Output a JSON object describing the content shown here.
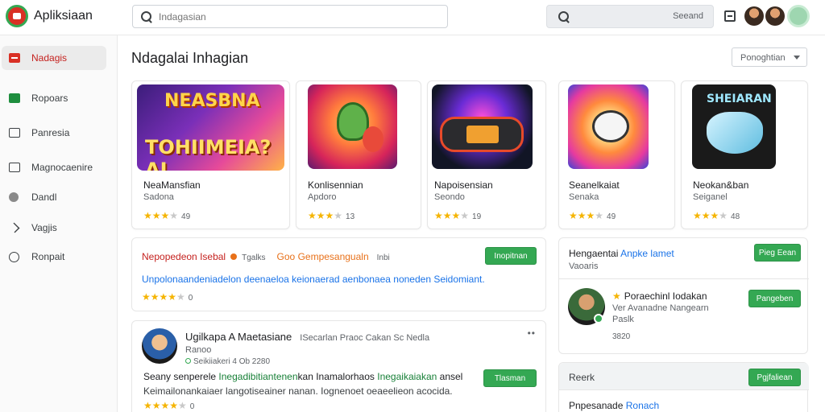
{
  "header": {
    "app_title": "Apliksiaan",
    "search_placeholder": "Indagasian",
    "second_search_label": "Seeand"
  },
  "sidebar": {
    "items": [
      {
        "label": "Nadagis",
        "icon": "red-square-icon",
        "active": true
      },
      {
        "label": "Ropoars",
        "icon": "green-store-icon",
        "active": false
      },
      {
        "label": "Panresia",
        "icon": "chart-icon",
        "active": false
      },
      {
        "label": "Magnocaenire",
        "icon": "grid-icon",
        "active": false
      },
      {
        "label": "Dandl",
        "icon": "circle-icon",
        "active": false
      },
      {
        "label": "Vagjis",
        "icon": "arrow-icon",
        "active": false
      },
      {
        "label": "Ronpait",
        "icon": "link-icon",
        "active": false
      }
    ]
  },
  "main": {
    "title": "Ndagalai Inhagian",
    "sort_label": "Ponoghtian"
  },
  "cards": [
    {
      "name": "NeaMansfian",
      "sub": "Sadona",
      "stars": 3,
      "rating": "49",
      "art_text1": "NEASBNA",
      "art_text2": "TOHIIMEIA?AL"
    },
    {
      "name": "Konlisennian",
      "sub": "Apdoro",
      "stars": 3,
      "rating": "13"
    },
    {
      "name": "Napoisensian",
      "sub": "Seondo",
      "stars": 3,
      "rating": "19"
    },
    {
      "name": "Seanelkaiat",
      "sub": "Senaka",
      "stars": 3,
      "rating": "49"
    },
    {
      "name": "Neokan&ban",
      "sub": "Seiganel",
      "stars": 3,
      "rating": "48",
      "art_text1": "SHEIARAN"
    }
  ],
  "review1": {
    "title": "Nepopedeon Isebal",
    "meta": "Tgalks",
    "tag": "Goo Gempesangualn",
    "date": "Inbi",
    "button": "Inopitnan",
    "body": "Unpolonaandeniadelon deenaeloa keionaerad aenbonaea noneden Seidomiant.",
    "stars": 4,
    "rating": "0"
  },
  "review2": {
    "name": "Ugilkapa A Maetasiane",
    "extra": "ISecarlan Praoc Cakan Sc Nedla",
    "sub": "Ranoo",
    "meta": "Seikiiakeri 4 Ob 2280",
    "more": "••",
    "button": "Tlasman",
    "line1_start": "Seany senperele",
    "line1_highlight": "Inegadibitiantenen",
    "line1_mid": "kan Inamalorhaos",
    "line1_highlight2": "Inegaikaiakan",
    "line1_end": "ansel",
    "line2": "Keimailonankaiaer langotiseainer nanan. Iognenoet oeaeelieon acocida.",
    "stars": 4,
    "rating": "0"
  },
  "right_panel": {
    "title_dark": "Hengaentai",
    "title_link": "Anpke lamet",
    "sub": "Vaoaris",
    "button1": "Pieg Eean",
    "user_name": "Poraechinl Iodakan",
    "user_sub1": "Ver Avanadne Nangearn",
    "user_sub2": "Paslk",
    "user_num": "3820",
    "button2": "Pangeben"
  },
  "right_panel2": {
    "head": "Reerk",
    "button": "Pgjfaliean",
    "line_dark": "Pnpesanade",
    "line_link": "Ronach"
  }
}
